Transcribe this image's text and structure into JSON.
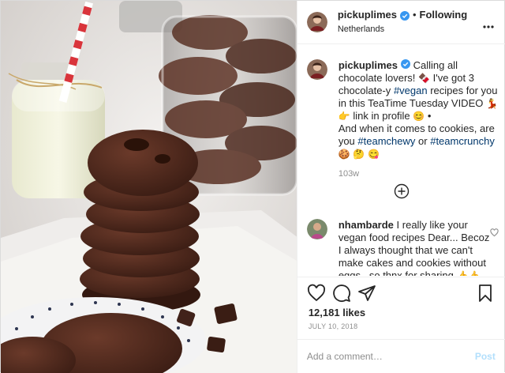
{
  "post": {
    "image_alt": "Stack of chocolate cookies beside a jar of cookies and a glass of milk",
    "header": {
      "username": "pickuplimes",
      "separator": "•",
      "follow_label": "Following",
      "location": "Netherlands"
    },
    "caption": {
      "username": "pickuplimes",
      "parts": {
        "p1": "Calling all chocolate lovers!",
        "e1": "🍫",
        "p2": "I've got 3 chocolate-y",
        "tag1": "#vegan",
        "p3": "recipes for you in this TeaTime Tuesday VIDEO",
        "e2": "💃",
        "e3": "👉",
        "p4": "link in profile",
        "e4": "😊",
        "p5": "•",
        "p6": "And when it comes to cookies, are you",
        "tag2": "#teamchewy",
        "p7": "or",
        "tag3": "#teamcrunchy",
        "e5": "🍪",
        "e6": "🤔",
        "e7": "😋"
      },
      "time": "103w"
    },
    "comment": {
      "username": "nhambarde",
      "text": "I really like your vegan food recipes Dear... Becoz I always thought that we can't make cakes and cookies without eggs.. so thnx for sharing",
      "emoji": "👍👍"
    },
    "likes": "12,181 likes",
    "date": "JULY 10, 2018",
    "add_comment": {
      "placeholder": "Add a comment…",
      "post_label": "Post"
    },
    "icons": {
      "more": "more-horizontal-icon",
      "load_more": "plus-circle-icon",
      "like": "heart-icon",
      "comment": "comment-icon",
      "share": "paper-plane-icon",
      "save": "bookmark-icon",
      "verified": "verified-badge-icon"
    },
    "colors": {
      "hashtag": "#00376b",
      "verified": "#3897f0",
      "post_button": "#b2dffc",
      "muted": "#8e8e8e"
    }
  }
}
